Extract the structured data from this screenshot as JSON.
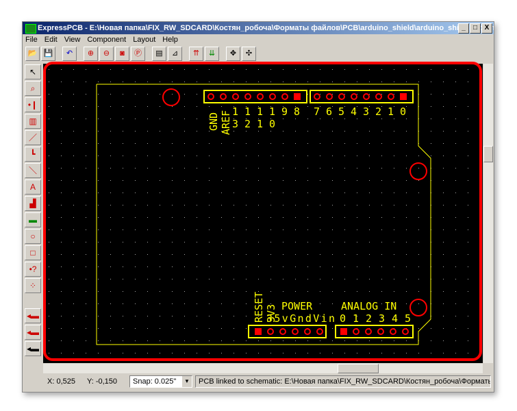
{
  "window": {
    "title": "ExpressPCB - E:\\Новая папка\\FIX_RW_SDCARD\\Костян_робоча\\Форматы файлов\\PCB\\arduino_shield\\arduino_shield\\arduino.pcb",
    "min": "_",
    "max": "□",
    "close": "X"
  },
  "menu": [
    "File",
    "Edit",
    "View",
    "Component",
    "Layout",
    "Help"
  ],
  "toolbar": [
    "open-icon",
    "save-icon",
    "undo-icon",
    "zoom-in-icon",
    "zoom-out-icon",
    "zoom-fit-icon",
    "zoom-previous-icon",
    "component-properties-icon",
    "pad-properties-icon",
    "top-layer-icon",
    "bottom-layer-icon",
    "move-icon",
    "move-group-icon"
  ],
  "left_tools": [
    "pointer-icon",
    "zoom-region-icon",
    "place-pad-icon",
    "place-component-icon",
    "trace-icon",
    "ground-icon",
    "diagonal-trace-icon",
    "text-icon",
    "copper-fill-icon",
    "place-part-icon",
    "circle-icon",
    "rectangle-icon",
    "query-icon",
    "net-icon"
  ],
  "pcb": {
    "top_left_labels": [
      "GND",
      "AREF"
    ],
    "top_numbers_row1": [
      "1",
      "1",
      "1",
      "1",
      "9",
      "8",
      "7",
      "6",
      "5",
      "4",
      "3",
      "2",
      "1",
      "0"
    ],
    "top_numbers_row2": [
      "3",
      "2",
      "1",
      "0"
    ],
    "bottom_vertical": [
      "RESET",
      "3V3"
    ],
    "power_label": "POWER",
    "power_pins": "35vGndVin",
    "analog_label": "ANALOG IN",
    "analog_pins": "0 1 2 3 4 5",
    "colors": {
      "silk": "#ffff00",
      "pad": "#ff0000",
      "background": "#000000",
      "annotation": "#ff0000"
    }
  },
  "status": {
    "x": "X: 0,525",
    "y": "Y: -0,150",
    "snap": "Snap:  0.025\"",
    "linked": "PCB linked to schematic:  E:\\Новая папка\\FIX_RW_SDCARD\\Костян_робоча\\Форматы"
  }
}
